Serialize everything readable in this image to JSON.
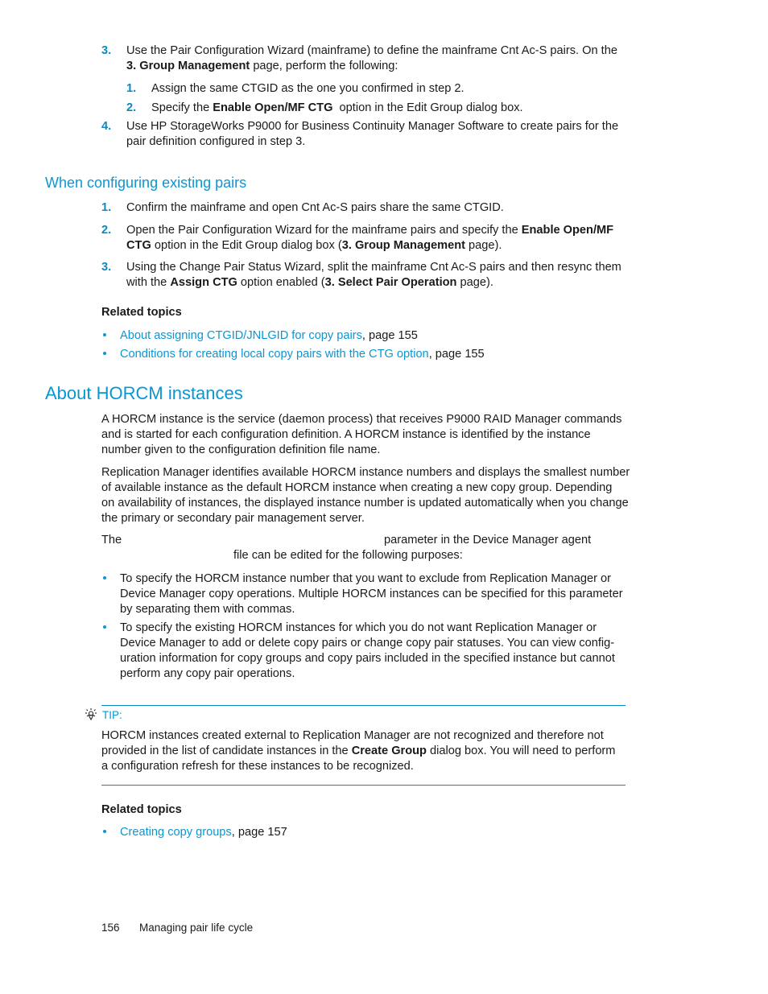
{
  "steps_top": [
    {
      "num": "3.",
      "line1": "Use the Pair Configuration Wizard (mainframe) to define the mainframe Cnt Ac-S pairs. On the",
      "line2_bold": "3. Group Management",
      "line2_rest": " page, perform the following:"
    },
    {
      "num": "1.",
      "pre": "Assign the same CTGID as the one you confirmed in step 2."
    },
    {
      "num": "2.",
      "pre": "Specify the ",
      "bold": "Enable Open/MF CTG",
      "post": "  option in the Edit Group dialog box."
    },
    {
      "num": "4.",
      "line1": "Use HP StorageWorks P9000 for Business Continuity Manager Software to create pairs for the",
      "line2": "pair definition configured in step 3."
    }
  ],
  "section_existing": {
    "heading": "When configuring existing pairs",
    "steps": [
      {
        "num": "1.",
        "text": "Confirm the mainframe and open Cnt Ac-S pairs share the same CTGID."
      },
      {
        "num": "2.",
        "l1_pre": "Open the Pair Configuration Wizard for the mainframe pairs and specify the ",
        "l1_bold": "Enable Open/MF",
        "l2_bold": "CTG",
        "l2_mid": " option in the Edit Group dialog box (",
        "l2_bold2": "3. Group Management",
        "l2_post": " page)."
      },
      {
        "num": "3.",
        "l1": "Using the Change Pair Status Wizard, split the mainframe Cnt Ac-S pairs and then resync them",
        "l2_pre": "with the ",
        "l2_bold": "Assign CTG",
        "l2_mid": " option enabled (",
        "l2_bold2": "3. Select Pair Operation",
        "l2_post": " page)."
      }
    ],
    "related_title": "Related topics",
    "related": [
      {
        "link": "About assigning CTGID/JNLGID for copy pairs",
        "suffix": ", page 155"
      },
      {
        "link": "Conditions for creating local copy pairs with the CTG option",
        "suffix": ", page 155"
      }
    ]
  },
  "section_horcm": {
    "heading": "About HORCM instances",
    "para1": [
      "A HORCM instance is the service (daemon process) that receives P9000 RAID Manager commands",
      "and is started for each configuration definition. A HORCM instance is identified by the instance",
      "number given to the configuration definition file name."
    ],
    "para2": [
      "Replication Manager identifies available HORCM instance numbers and displays the smallest number",
      "of available instance as the default HORCM instance when creating a new copy group. Depending",
      "on availability of instances, the displayed instance number is updated automatically when you change",
      "the primary or secondary pair management server."
    ],
    "para3_a": "The",
    "para3_b": "parameter in the Device Manager agent",
    "para3_c": "file can be edited for the following purposes:",
    "bullets": [
      [
        "To specify the HORCM instance number that you want to exclude from Replication Manager or",
        "Device Manager copy operations. Multiple HORCM instances can be specified for this parameter",
        "by separating them with commas."
      ],
      [
        "To specify the existing HORCM instances for which you do not want Replication Manager or",
        "Device Manager to add or delete copy pairs or change copy pair statuses. You can view config-",
        "uration information for copy groups and copy pairs included in the specified instance but cannot",
        "perform any copy pair operations."
      ]
    ],
    "tip": {
      "label": "TIP:",
      "icon": "lightbulb-icon",
      "l1": "HORCM instances created external to Replication Manager are not recognized and therefore not",
      "l2_pre": "provided in the list of candidate instances in the ",
      "l2_bold": "Create Group",
      "l2_post": " dialog box. You will need to perform",
      "l3": "a configuration refresh for these instances to be recognized."
    },
    "related_title": "Related topics",
    "related": [
      {
        "link": "Creating copy groups",
        "suffix": ", page 157"
      }
    ]
  },
  "footer": {
    "page_number": "156",
    "chapter": "Managing pair life cycle"
  }
}
